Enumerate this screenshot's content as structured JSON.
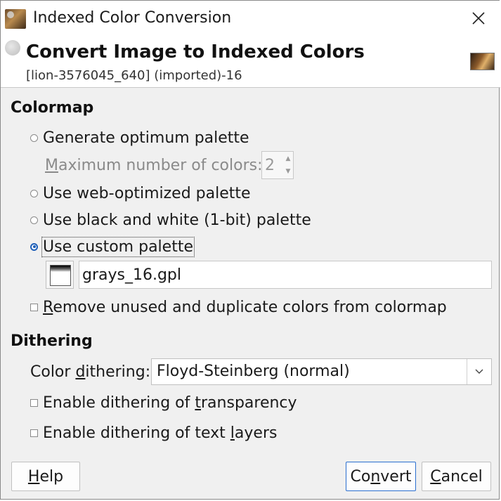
{
  "window": {
    "title": "Indexed Color Conversion"
  },
  "header": {
    "heading": "Convert Image to Indexed Colors",
    "subtitle": "[lion-3576045_640] (imported)-16"
  },
  "colormap": {
    "section_title": "Colormap",
    "options": {
      "optimum": "Generate optimum palette",
      "max_colors_label_underlined": "M",
      "max_colors_label_rest": "aximum number of colors:",
      "max_colors_value": "2",
      "web": "Use web-optimized palette",
      "bw": "Use black and white (1-bit) palette",
      "custom": "Use custom palette"
    },
    "selected_option": "custom",
    "palette_name": "grays_16.gpl",
    "remove_unused_underlined": "R",
    "remove_unused_rest": "emove unused and duplicate colors from colormap",
    "remove_unused_checked": false
  },
  "dithering": {
    "section_title": "Dithering",
    "color_label_pre": "Color ",
    "color_label_underlined": "d",
    "color_label_post": "ithering:",
    "color_value": "Floyd-Steinberg (normal)",
    "transparency_pre": "Enable dithering of ",
    "transparency_underlined": "t",
    "transparency_post": "ransparency",
    "transparency_checked": false,
    "text_pre": "Enable dithering of text ",
    "text_underlined": "l",
    "text_post": "ayers",
    "text_checked": false
  },
  "buttons": {
    "help_underlined": "H",
    "help_rest": "elp",
    "convert_pre": "Co",
    "convert_underlined": "n",
    "convert_post": "vert",
    "cancel_underlined": "C",
    "cancel_rest": "ancel"
  },
  "colors": {
    "accent": "#1f5fb8",
    "default_button_border": "#2a6fcf"
  }
}
